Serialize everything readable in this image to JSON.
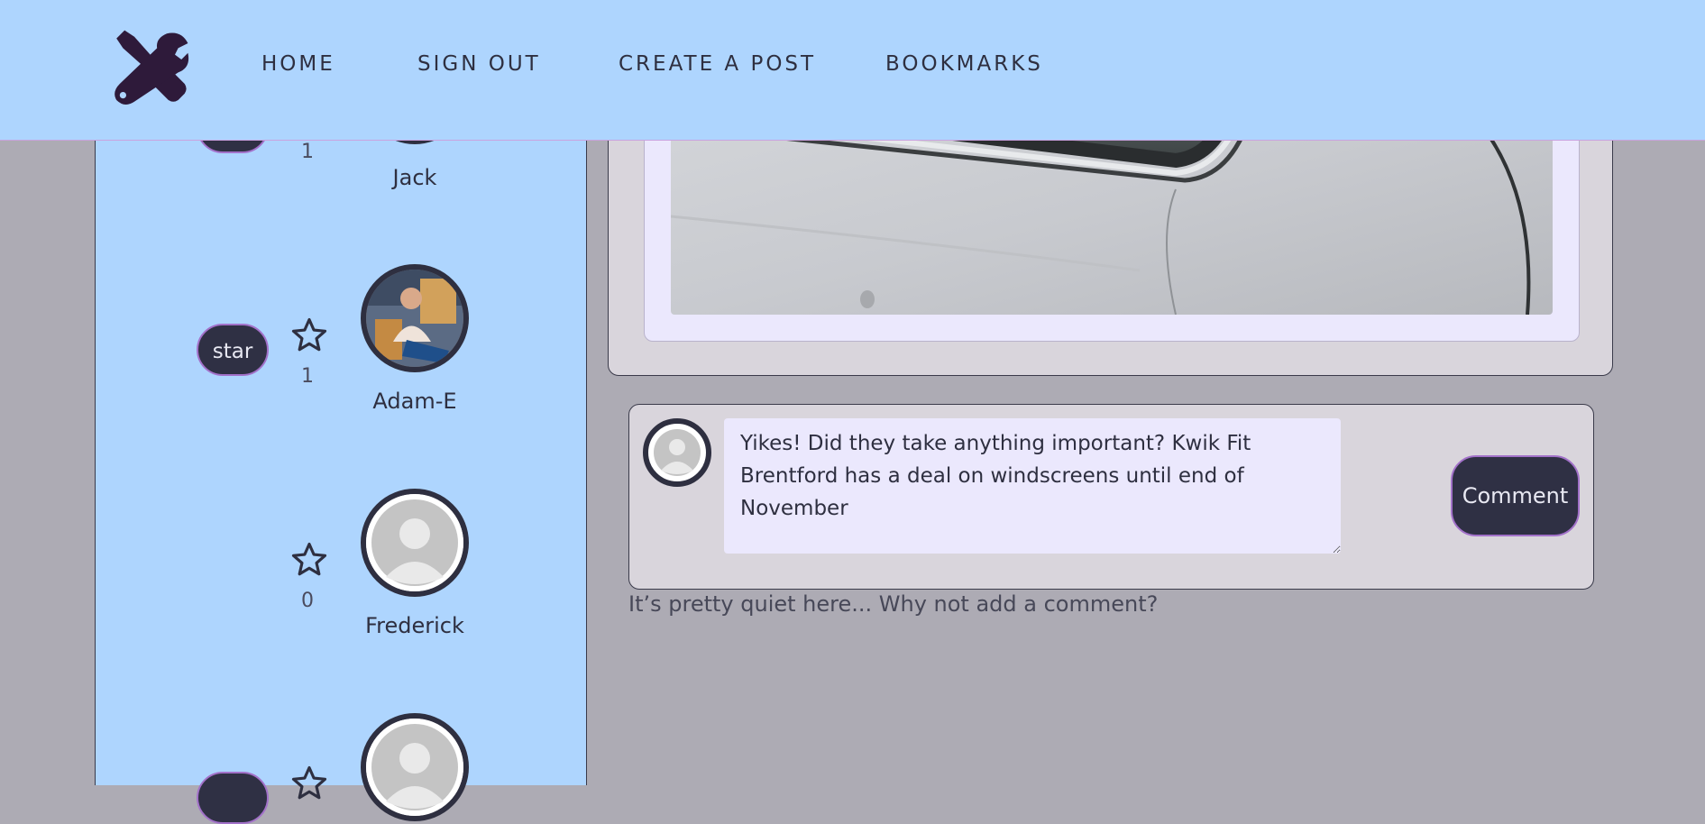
{
  "nav": {
    "logo_icon": "tools-icon",
    "links": [
      "HOME",
      "SIGN OUT",
      "CREATE A POST",
      "BOOKMARKS"
    ]
  },
  "sidebar": {
    "users": [
      {
        "name": "Jack",
        "stars": "1",
        "badge": ""
      },
      {
        "name": "Adam-E",
        "stars": "1",
        "badge": "star"
      },
      {
        "name": "Frederick",
        "stars": "0",
        "badge": ""
      },
      {
        "name": "",
        "stars": "",
        "badge": ""
      }
    ]
  },
  "comment_form": {
    "text": "Yikes! Did they take anything important? Kwik Fit Brentford has a deal on windscreens until end of November",
    "button_label": "Comment"
  },
  "comments": {
    "empty_message": "It’s pretty quiet here... Why not add a comment?"
  },
  "colors": {
    "header_bg": "#aed5fe",
    "page_bg": "#adabb4",
    "button_bg": "#2f3044",
    "button_border": "#a271c9"
  }
}
